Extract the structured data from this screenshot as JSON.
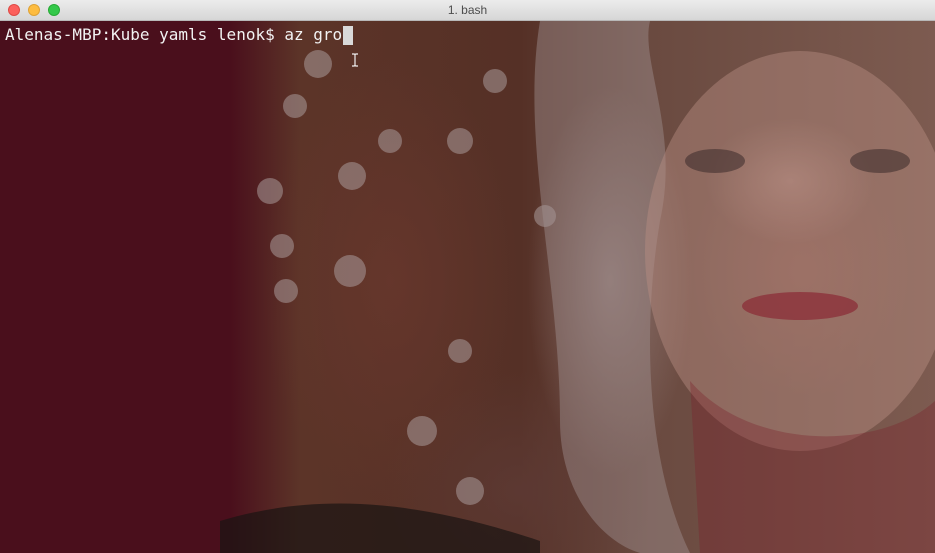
{
  "window": {
    "title": "1. bash",
    "traffic_lights": [
      {
        "name": "close",
        "color": "#fc605c"
      },
      {
        "name": "minimize",
        "color": "#fdbc40"
      },
      {
        "name": "zoom",
        "color": "#34c84a"
      }
    ]
  },
  "terminal": {
    "prompt": "Alenas-MBP:Kube yamls lenok$",
    "command": "az gro",
    "text_color": "#f2f2f2",
    "background_left_color": "#4a0f1c",
    "cursor": "block-cursor",
    "pointer": "i-beam-cursor-icon"
  }
}
